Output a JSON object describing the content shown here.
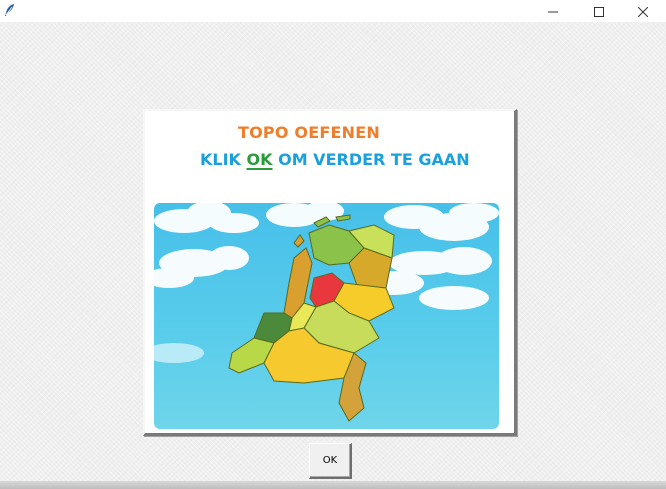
{
  "window": {
    "icon": "feather-icon",
    "controls": [
      "minimize-icon",
      "maximize-icon",
      "close-icon"
    ]
  },
  "panel": {
    "title": "TOPO OEFENEN",
    "instruction_prefix": "KLIK ",
    "instruction_ok": "OK",
    "instruction_suffix": " OM VERDER TE GAAN",
    "image": "map-of-netherlands-provinces-with-clouds"
  },
  "button": {
    "label": "OK"
  },
  "colors": {
    "title": "#f07d2a",
    "instruction": "#1aa0dc",
    "ok_highlight": "#2a9c3c",
    "sky_top": "#4fc3ea",
    "sky_bottom": "#5ed0ea",
    "highlighted_province": "#e8383d"
  }
}
